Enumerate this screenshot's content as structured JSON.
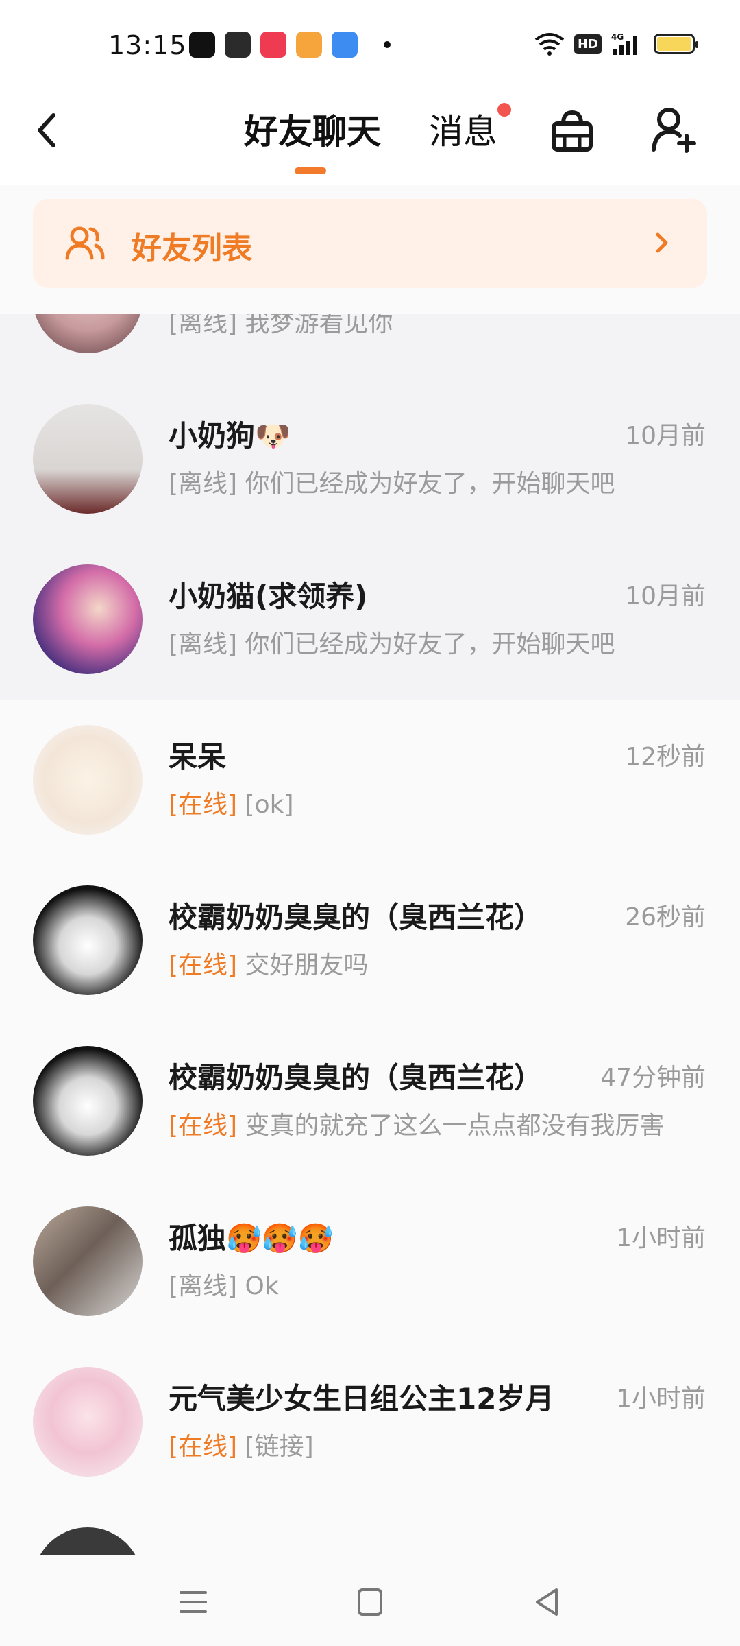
{
  "status_bar": {
    "time": "13:15",
    "network": "4G",
    "hd_label": "HD",
    "icons": [
      "tiktok-app-icon",
      "notes-app-icon",
      "music-app-icon",
      "video-app-icon",
      "blue-app-icon"
    ]
  },
  "header": {
    "tab_friend_chat": "好友聊天",
    "tab_messages": "消息",
    "accent_color": "#f27a2a",
    "badge_color": "#f2554f"
  },
  "banner": {
    "label": "好友列表"
  },
  "chats": [
    {
      "name": "",
      "time": "",
      "status": "[离线]",
      "online": false,
      "preview": "我梦游看见你",
      "pinned": true
    },
    {
      "name": "小奶狗🐶",
      "time": "10月前",
      "status": "[离线]",
      "online": false,
      "preview": "你们已经成为好友了，开始聊天吧",
      "pinned": true
    },
    {
      "name": "小奶猫(求领养)",
      "time": "10月前",
      "status": "[离线]",
      "online": false,
      "preview": "你们已经成为好友了，开始聊天吧",
      "pinned": true
    },
    {
      "name": "呆呆",
      "time": "12秒前",
      "status": "[在线]",
      "online": true,
      "preview": "[ok]",
      "pinned": false
    },
    {
      "name": "校霸奶奶臭臭的（臭西兰花）",
      "time": "26秒前",
      "status": "[在线]",
      "online": true,
      "preview": "交好朋友吗",
      "pinned": false
    },
    {
      "name": "校霸奶奶臭臭的（臭西兰花）",
      "time": "47分钟前",
      "status": "[在线]",
      "online": true,
      "preview": "变真的就充了这么一点点都没有我厉害",
      "pinned": false
    },
    {
      "name": "孤独🥵🥵🥵",
      "time": "1小时前",
      "status": "[离线]",
      "online": false,
      "preview": "Ok",
      "pinned": false
    },
    {
      "name": "元气美少女生日组公主12岁月",
      "time": "1小时前",
      "status": "[在线]",
      "online": true,
      "preview": "[链接]",
      "pinned": false
    }
  ]
}
